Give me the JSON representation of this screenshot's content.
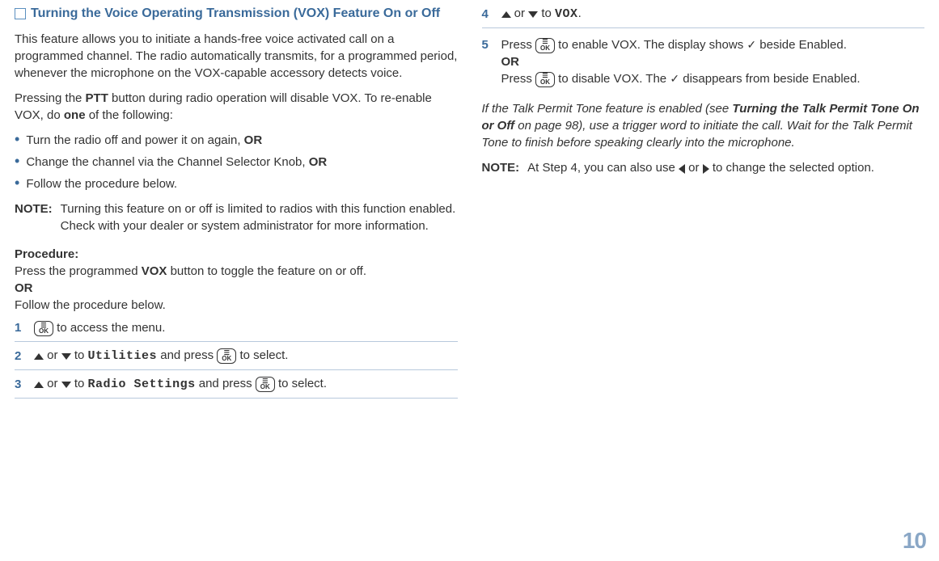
{
  "left": {
    "heading": "Turning the Voice Operating Transmission (VOX) Feature On or Off",
    "p1": "This feature allows you to initiate a hands-free voice activated call on a programmed channel. The radio automatically transmits, for a programmed period, whenever the microphone on the VOX-capable accessory detects voice.",
    "p2_a": "Pressing the ",
    "p2_ptt": "PTT",
    "p2_b": " button during radio operation will disable VOX. To re-enable VOX, do ",
    "p2_one": "one",
    "p2_c": " of the following:",
    "bullet1_a": "Turn the radio off and power it on again, ",
    "bullet1_or": "OR",
    "bullet2_a": "Change the channel via the Channel Selector Knob, ",
    "bullet2_or": "OR",
    "bullet3": "Follow the procedure below.",
    "note_label": "NOTE:",
    "note_text": "Turning this feature on or off is limited to radios with this function enabled. Check with your dealer or system administrator for more information.",
    "procedure": "Procedure:",
    "proc_line1_a": "Press the programmed ",
    "proc_line1_vox": "VOX",
    "proc_line1_b": " button to toggle the feature on or off.",
    "proc_or": "OR",
    "proc_line2": "Follow the procedure below.",
    "step1_num": "1",
    "step1_text": " to access the menu.",
    "step2_num": "2",
    "step2_or": " or ",
    "step2_to": " to ",
    "step2_util": "Utilities",
    "step2_and": " and press ",
    "step2_sel": " to select.",
    "step3_num": "3",
    "step3_or": " or ",
    "step3_to": " to ",
    "step3_rs": "Radio Settings",
    "step3_and": " and press ",
    "step3_sel": " to select."
  },
  "right": {
    "step4_num": "4",
    "step4_or": " or ",
    "step4_to": " to ",
    "step4_vox": "VOX",
    "step4_dot": ".",
    "step5_num": "5",
    "step5_a": "Press ",
    "step5_b": " to enable VOX. The display shows ",
    "step5_c": " beside Enabled.",
    "step5_or": "OR",
    "step5_d": "Press ",
    "step5_e": " to disable VOX. The ",
    "step5_f": " disappears from beside Enabled.",
    "italic_a": "If the Talk Permit Tone feature is enabled (see ",
    "italic_bold": "Turning the Talk Permit Tone On or Off",
    "italic_b": " on page 98), use a trigger word to initiate the call. Wait for the Talk Permit Tone to finish before speaking clearly into the microphone.",
    "note_label": "NOTE:",
    "note_a": "At Step 4, you can also use ",
    "note_or": " or ",
    "note_b": " to change the selected option."
  },
  "page_number": "10"
}
